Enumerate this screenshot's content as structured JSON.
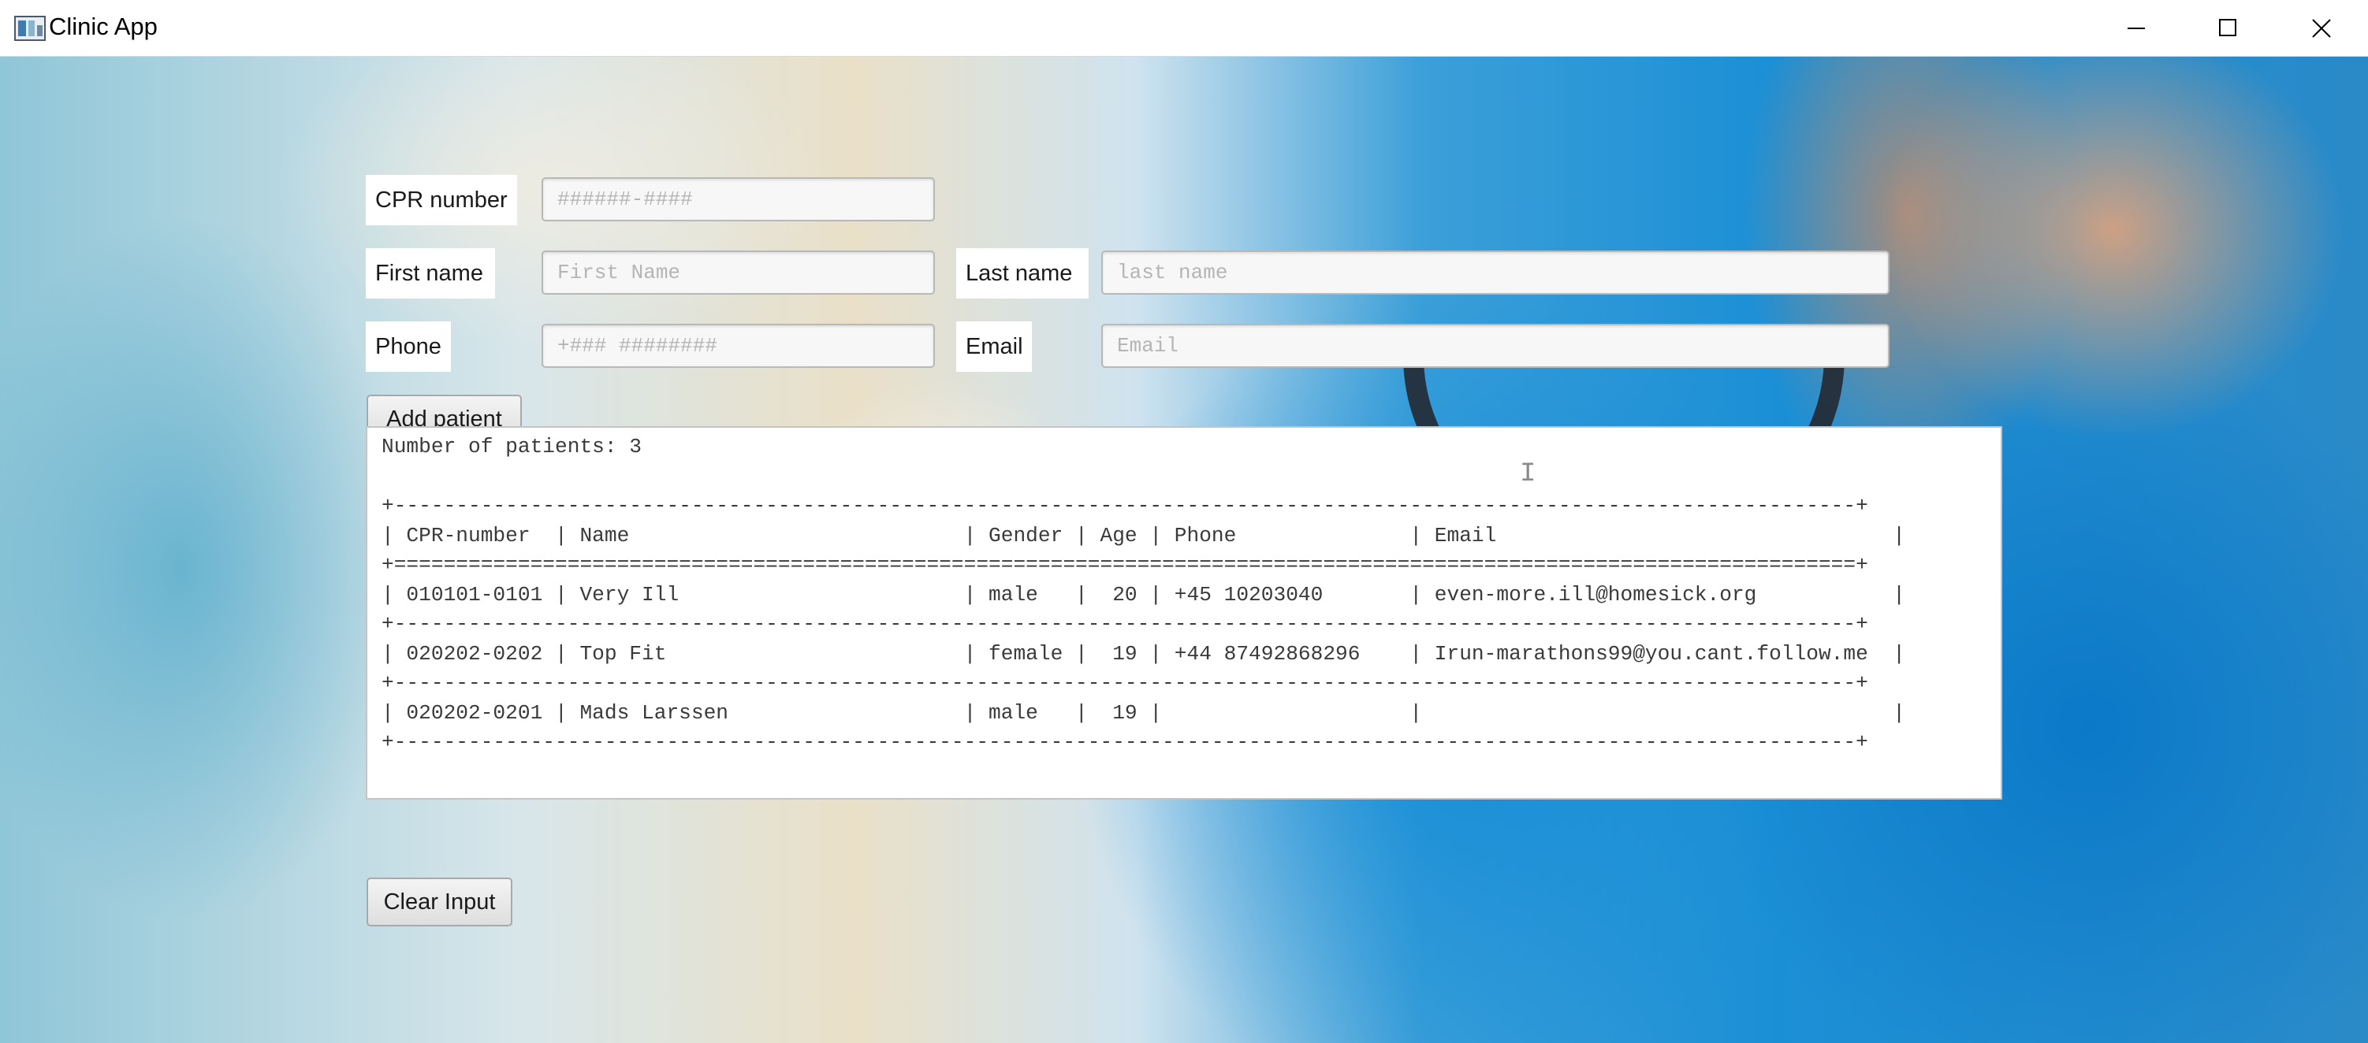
{
  "window": {
    "title": "Clinic App",
    "icon": "app-window-icon",
    "controls": {
      "minimize": "minimize-icon",
      "maximize": "maximize-icon",
      "close": "close-icon"
    }
  },
  "form": {
    "cpr": {
      "label": "CPR number",
      "placeholder": "######-####",
      "value": ""
    },
    "first_name": {
      "label": "First name",
      "placeholder": "First Name",
      "value": ""
    },
    "last_name": {
      "label": "Last name",
      "placeholder": "last name",
      "value": ""
    },
    "phone": {
      "label": "Phone",
      "placeholder": "+### ########",
      "value": ""
    },
    "email": {
      "label": "Email",
      "placeholder": "Email",
      "value": ""
    },
    "add_button": "Add patient"
  },
  "output": {
    "summary": "Number of patients: 3",
    "lines": [
      "",
      "+----------------------------------------------------------------------------------------------------------------------+",
      "| CPR-number  | Name                           | Gender | Age | Phone              | Email                                |",
      "+======================================================================================================================+",
      "| 010101-0101 | Very Ill                       | male   |  20 | +45 10203040       | even-more.ill@homesick.org           |",
      "+----------------------------------------------------------------------------------------------------------------------+",
      "| 020202-0202 | Top Fit                        | female |  19 | +44 87492868296    | Irun-marathons99@you.cant.follow.me  |",
      "+----------------------------------------------------------------------------------------------------------------------+",
      "| 020202-0201 | Mads Larssen                   | male   |  19 |                    |                                      |",
      "+----------------------------------------------------------------------------------------------------------------------+"
    ]
  },
  "clear_button": "Clear Input",
  "colors": {
    "background_blue": "#1b8fd6",
    "panel": "#ffffff",
    "button_border": "#a9a9a9"
  }
}
